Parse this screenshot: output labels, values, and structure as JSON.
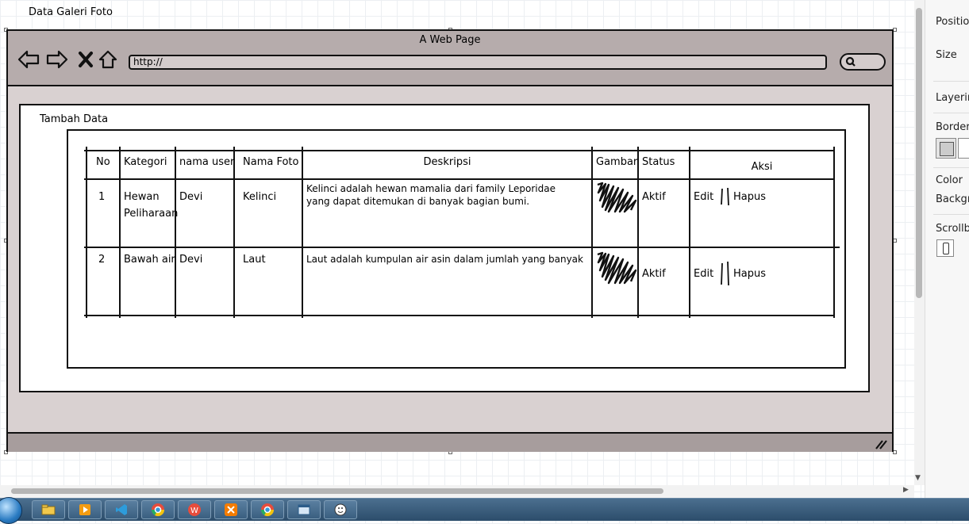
{
  "canvas_title": "Data Galeri Foto",
  "mockup": {
    "window_title": "A Web Page",
    "url": "http://",
    "panel_title": "Tambah Data"
  },
  "table": {
    "headers": [
      "No",
      "Kategori",
      "nama user",
      "Nama Foto",
      "Deskripsi",
      "Gambar",
      "Status",
      "Aksi"
    ],
    "rows": [
      {
        "no": "1",
        "kategori_line1": "Hewan",
        "kategori_line2": "Peliharaan",
        "nama_user": "Devi",
        "nama_foto": "Kelinci",
        "deskripsi_line1": "Kelinci adalah hewan mamalia dari family Leporidae",
        "deskripsi_line2": "yang dapat ditemukan di banyak bagian bumi.",
        "status": "Aktif",
        "edit": "Edit",
        "hapus": "Hapus"
      },
      {
        "no": "2",
        "kategori_line1": "Bawah air",
        "kategori_line2": "",
        "nama_user": "Devi",
        "nama_foto": "Laut",
        "deskripsi_line1": "Laut adalah kumpulan air asin dalam jumlah yang banyak",
        "deskripsi_line2": "",
        "status": "Aktif",
        "edit": "Edit",
        "hapus": "Hapus"
      }
    ]
  },
  "properties_panel": {
    "labels": [
      "Positio",
      "Size",
      "Layerin",
      "Border",
      "Color",
      "Backgr",
      "Scrollb"
    ]
  },
  "taskbar": {
    "icons": [
      "windows-start-icon",
      "file-explorer-icon",
      "media-player-icon",
      "vscode-icon",
      "chrome-icon",
      "wps-office-icon",
      "xampp-icon",
      "chrome-icon",
      "window-app-icon",
      "smiley-icon"
    ]
  }
}
